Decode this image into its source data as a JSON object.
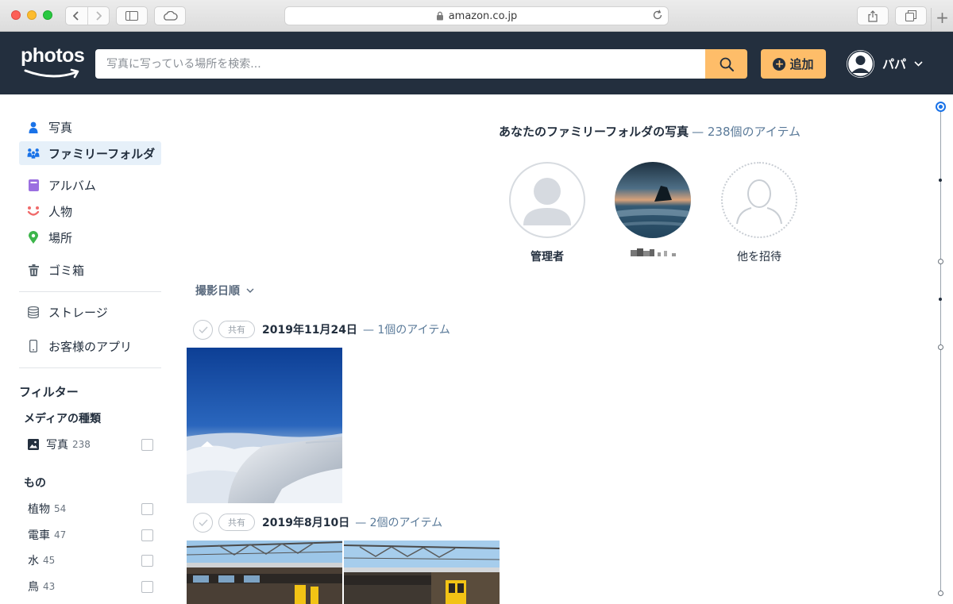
{
  "browser": {
    "url": "amazon.co.jp"
  },
  "header": {
    "logo_text": "photos",
    "search_placeholder": "写真に写っている場所を検索...",
    "add_label": "追加",
    "user_name": "パパ"
  },
  "sidebar": {
    "nav": [
      {
        "label": "写真",
        "icon": "person-icon"
      },
      {
        "label": "ファミリーフォルダ",
        "icon": "family-icon",
        "active": true
      },
      {
        "label": "アルバム",
        "icon": "album-icon"
      },
      {
        "label": "人物",
        "icon": "smile-icon"
      },
      {
        "label": "場所",
        "icon": "map-pin-icon"
      },
      {
        "label": "ゴミ箱",
        "icon": "trash-icon"
      },
      {
        "label": "ストレージ",
        "icon": "database-icon"
      },
      {
        "label": "お客様のアプリ",
        "icon": "phone-icon"
      }
    ],
    "filter_heading": "フィルター",
    "media_heading": "メディアの種類",
    "media_items": [
      {
        "label": "写真",
        "count": "238"
      }
    ],
    "things_heading": "もの",
    "things_items": [
      {
        "label": "植物",
        "count": "54"
      },
      {
        "label": "電車",
        "count": "47"
      },
      {
        "label": "水",
        "count": "45"
      },
      {
        "label": "鳥",
        "count": "43"
      }
    ]
  },
  "main": {
    "family_title": "あなたのファミリーフォルダの写真",
    "family_count": "— 238個のアイテム",
    "members": [
      {
        "name": "管理者"
      },
      {
        "name": ""
      },
      {
        "name": "他を招待"
      }
    ],
    "sort_label": "撮影日順",
    "groups": [
      {
        "share_label": "共有",
        "date": "2019年11月24日",
        "count": "— 1個のアイテム"
      },
      {
        "share_label": "共有",
        "date": "2019年8月10日",
        "count": "— 2個のアイテム"
      }
    ]
  },
  "colors": {
    "header_bg": "#232f3e",
    "accent_orange": "#febd69",
    "link_blue": "#5a7a99",
    "active_bg": "#e6f0f9"
  }
}
